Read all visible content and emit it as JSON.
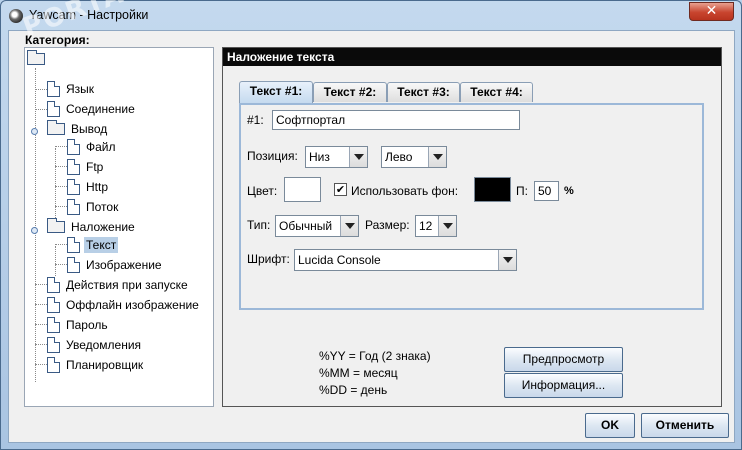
{
  "window": {
    "title": "Yawcam - Настройки"
  },
  "category": {
    "label": "Категория:",
    "items": [
      {
        "label": "Язык"
      },
      {
        "label": "Соединение"
      },
      {
        "label": "Вывод"
      },
      {
        "label": "Файл"
      },
      {
        "label": "Ftp"
      },
      {
        "label": "Http"
      },
      {
        "label": "Поток"
      },
      {
        "label": "Наложение"
      },
      {
        "label": "Текст"
      },
      {
        "label": "Изображение"
      },
      {
        "label": "Действия при запуске"
      },
      {
        "label": "Оффлайн изображение"
      },
      {
        "label": "Пароль"
      },
      {
        "label": "Уведомления"
      },
      {
        "label": "Планировщик"
      }
    ]
  },
  "panel": {
    "title": "Наложение текста",
    "tabs": [
      "Текст #1:",
      "Текст #2:",
      "Текст #3:",
      "Текст #4:"
    ],
    "text1_label": "#1:",
    "text1_value": "Софтпортал",
    "position_label": "Позиция:",
    "position_vertical": "Низ",
    "position_horizontal": "Лево",
    "color_label": "Цвет:",
    "color_value": "#ffffff",
    "use_background_label": "Использовать фон:",
    "use_background_checked": true,
    "background_color": "#000000",
    "opacity_label": "П:",
    "opacity_value": "50",
    "opacity_unit": "%",
    "type_label": "Тип:",
    "type_value": "Обычный",
    "size_label": "Размер:",
    "size_value": "12",
    "font_label": "Шрифт:",
    "font_value": "Lucida Console",
    "info_lines": [
      "%YY = Год (2 знака)",
      "%MM = месяц",
      "%DD = день"
    ],
    "preview_button": "Предпросмотр",
    "info_button": "Информация..."
  },
  "footer": {
    "ok_button": "OK",
    "cancel_button": "Отменить"
  },
  "watermark": "PORTAL"
}
